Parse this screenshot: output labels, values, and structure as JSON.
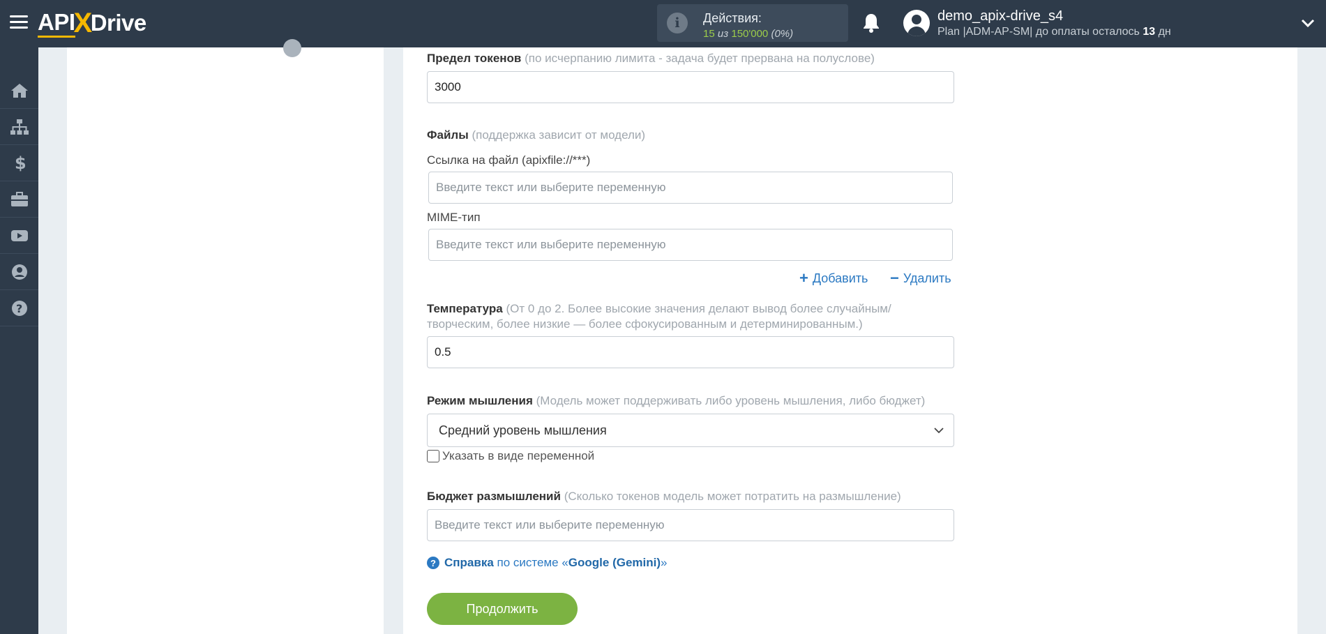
{
  "header": {
    "logo_api": "API",
    "logo_x": "X",
    "logo_drive": "Drive",
    "actions_label": "Действия:",
    "actions_used": "15",
    "actions_of": "из",
    "actions_total": "150'000",
    "actions_percent": "(0%)",
    "user_name": "demo_apix-drive_s4",
    "plan_prefix": "Plan |ADM-AP-SM| до оплаты осталось",
    "plan_days": "13",
    "plan_suffix": "дн"
  },
  "sidebar": {
    "items": [
      "home-icon",
      "sitemap-icon",
      "dollar-icon",
      "briefcase-icon",
      "youtube-icon",
      "user-circle-icon",
      "question-circle-icon"
    ]
  },
  "form": {
    "tokens": {
      "label": "Предел токенов",
      "hint": "(по исчерпанию лимита - задача будет прервана на полуслове)",
      "value": "3000"
    },
    "files": {
      "label": "Файлы",
      "hint": "(поддержка зависит от модели)",
      "link_label": "Ссылка на файл (apixfile://***)",
      "link_placeholder": "Введите текст или выберите переменную",
      "mime_label": "MIME-тип",
      "mime_placeholder": "Введите текст или выберите переменную",
      "add_label": "Добавить",
      "remove_label": "Удалить"
    },
    "temperature": {
      "label": "Температура",
      "hint_line1": "(От 0 до 2. Более высокие значения делают вывод более случайным/",
      "hint_line2": "творческим, более низкие — более сфокусированным и детерминированным.)",
      "value": "0.5"
    },
    "thinking_mode": {
      "label": "Режим мышления",
      "hint": "(Модель может поддерживать либо уровень мышления, либо бюджет)",
      "selected": "Средний уровень мышления",
      "as_variable_label": "Указать в виде переменной"
    },
    "thinking_budget": {
      "label": "Бюджет размышлений",
      "hint": "(Сколько токенов модель может потратить на размышление)",
      "placeholder": "Введите текст или выберите переменную"
    },
    "help": {
      "link_text": "Справка",
      "middle": "по системе «",
      "system": "Google (Gemini)",
      "end": "»"
    },
    "continue_label": "Продолжить"
  },
  "colors": {
    "topbar": "#2e3b4a",
    "accent_link": "#2b79c2",
    "button_green": "#7cb342",
    "logo_yellow": "#f5b800"
  }
}
